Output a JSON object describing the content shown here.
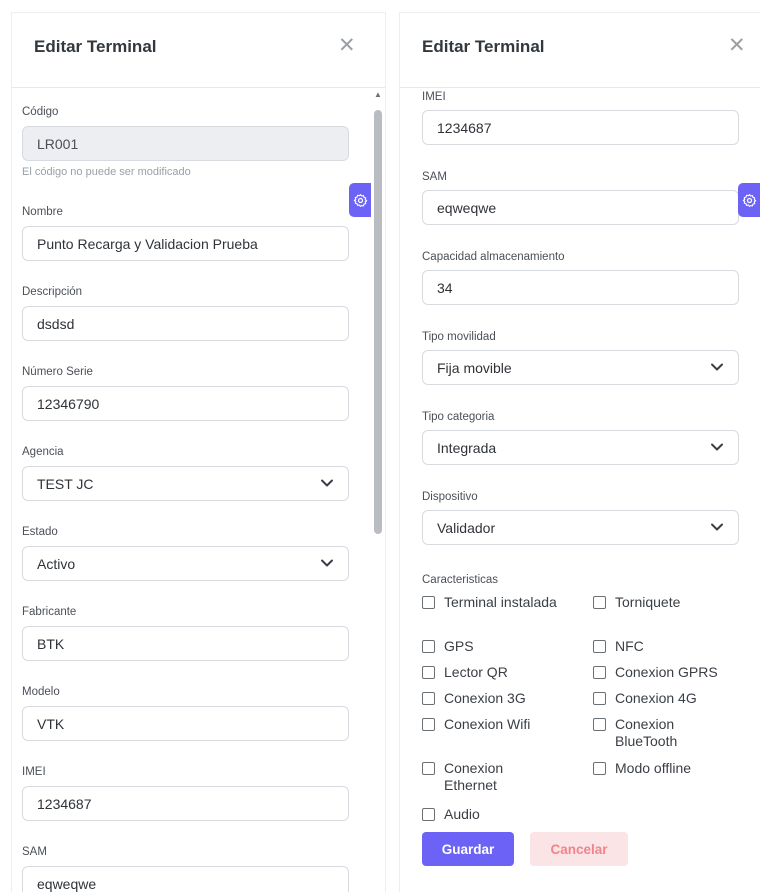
{
  "left_panel": {
    "title": "Editar Terminal",
    "close_icon": "✕",
    "fields": {
      "codigo": {
        "label": "Código",
        "value": "LR001",
        "help": "El código no puede ser modificado"
      },
      "nombre": {
        "label": "Nombre",
        "value": "Punto Recarga y Validacion Prueba"
      },
      "descripcion": {
        "label": "Descripción",
        "value": "dsdsd"
      },
      "numero_serie": {
        "label": "Número Serie",
        "value": "12346790"
      },
      "agencia": {
        "label": "Agencia",
        "value": "TEST JC"
      },
      "estado": {
        "label": "Estado",
        "value": "Activo"
      },
      "fabricante": {
        "label": "Fabricante",
        "value": "BTK"
      },
      "modelo": {
        "label": "Modelo",
        "value": "VTK"
      },
      "imei": {
        "label": "IMEI",
        "value": "1234687"
      },
      "sam": {
        "label": "SAM",
        "value": "eqweqwe"
      }
    }
  },
  "right_panel": {
    "title": "Editar Terminal",
    "close_icon": "✕",
    "fields": {
      "imei": {
        "label": "IMEI",
        "value": "1234687"
      },
      "sam": {
        "label": "SAM",
        "value": "eqweqwe"
      },
      "capacidad": {
        "label": "Capacidad almacenamiento",
        "value": "34"
      },
      "tipo_movilidad": {
        "label": "Tipo movilidad",
        "value": "Fija movible"
      },
      "tipo_categoria": {
        "label": "Tipo categoria",
        "value": "Integrada"
      },
      "dispositivo": {
        "label": "Dispositivo",
        "value": "Validador"
      }
    },
    "caracteristicas_label": "Caracteristicas",
    "caracteristicas": [
      {
        "label": "Terminal instalada",
        "checked": false
      },
      {
        "label": "Torniquete",
        "checked": false
      },
      {
        "label": "GPS",
        "checked": false
      },
      {
        "label": "NFC",
        "checked": false
      },
      {
        "label": "Lector QR",
        "checked": false
      },
      {
        "label": "Conexion GPRS",
        "checked": false
      },
      {
        "label": "Conexion 3G",
        "checked": false
      },
      {
        "label": "Conexion 4G",
        "checked": false
      },
      {
        "label": "Conexion Wifi",
        "checked": false
      },
      {
        "label": "Conexion BlueTooth",
        "checked": false
      },
      {
        "label": "Conexion Ethernet",
        "checked": false
      },
      {
        "label": "Modo offline",
        "checked": false
      },
      {
        "label": "Audio",
        "checked": false
      }
    ],
    "buttons": {
      "save": "Guardar",
      "cancel": "Cancelar"
    }
  },
  "icons": {
    "settings": "gear-icon",
    "chevron": "chevron-down-icon",
    "close": "close-icon"
  },
  "colors": {
    "primary": "#6c63f6",
    "cancel_bg": "#fbe4e6",
    "cancel_text": "#f0848c"
  }
}
